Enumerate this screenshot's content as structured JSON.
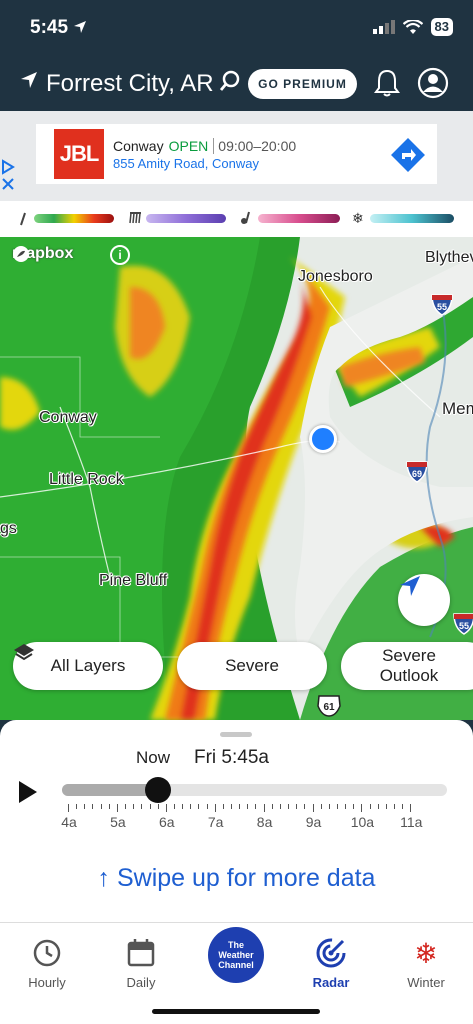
{
  "status": {
    "time": "5:45",
    "battery": "83"
  },
  "header": {
    "location": "Forrest City, AR",
    "premium_label": "GO PREMIUM"
  },
  "ad": {
    "brand": "JBL",
    "name": "Conway",
    "status": "OPEN",
    "hours": "09:00–20:00",
    "address": "855 Amity Road, Conway"
  },
  "legend": {
    "colors": {
      "rain": "#2fa84f",
      "mix": "#8f6ed8",
      "ice": "#d84e8e",
      "snow": "#4cc2cf"
    }
  },
  "map": {
    "attribution": "mapbox",
    "cities": [
      "Jonesboro",
      "Blythev",
      "Mem",
      "Conway",
      "Little Rock",
      "Pine Bluff",
      "gs"
    ],
    "shields": [
      "55",
      "69",
      "55",
      "61"
    ]
  },
  "chips": {
    "all_layers": "All Layers",
    "severe": "Severe",
    "severe_outlook": "Severe\nOutlook"
  },
  "timeline": {
    "now_label": "Now",
    "time_label": "Fri 5:45a",
    "hours": [
      "4a",
      "5a",
      "6a",
      "7a",
      "8a",
      "9a",
      "10a",
      "11a"
    ],
    "progress": 0.25
  },
  "swipe_text": "↑ Swipe up for more data",
  "tabs": [
    {
      "label": "Hourly"
    },
    {
      "label": "Daily"
    },
    {
      "label": "The Weather Channel"
    },
    {
      "label": "Radar"
    },
    {
      "label": "Winter"
    }
  ],
  "colors": {
    "header_bg": "#1f3341",
    "accent": "#1f5fd1",
    "radar_tab": "#1e3fb0",
    "winter_icon": "#d3261f"
  }
}
